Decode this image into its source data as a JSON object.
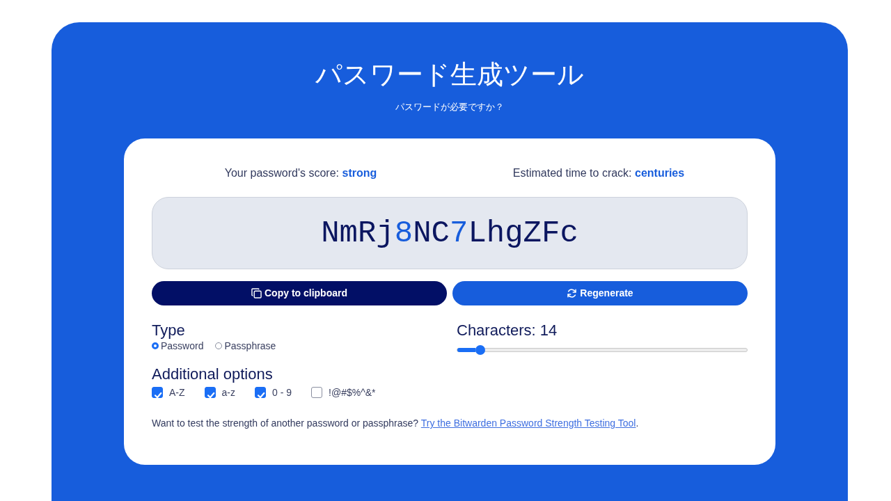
{
  "header": {
    "title": "パスワード生成ツール",
    "subtitle": "パスワードが必要ですか？"
  },
  "stats": [
    {
      "label": "Your password's score:",
      "value": "strong"
    },
    {
      "label": "Estimated time to crack:",
      "value": "centuries"
    }
  ],
  "password": [
    {
      "text": "NmRj",
      "kind": "letter"
    },
    {
      "text": "8",
      "kind": "digit"
    },
    {
      "text": "NC",
      "kind": "letter"
    },
    {
      "text": "7",
      "kind": "digit"
    },
    {
      "text": "LhgZFc",
      "kind": "letter"
    }
  ],
  "buttons": [
    {
      "label": "Copy to clipboard",
      "kind": "copy"
    },
    {
      "label": "Regenerate",
      "kind": "regenerate"
    }
  ],
  "type": {
    "heading": "Type",
    "options": [
      {
        "label": "Password",
        "selected": true
      },
      {
        "label": "Passphrase",
        "selected": false
      }
    ]
  },
  "length": {
    "label": "Characters: 14",
    "level": 0.08
  },
  "options": {
    "heading": "Additional options",
    "items": [
      {
        "label": "A-Z",
        "checked": true
      },
      {
        "label": "a-z",
        "checked": true
      },
      {
        "label": "0 - 9",
        "checked": true
      },
      {
        "label": "!@#$%^&*",
        "checked": false
      }
    ]
  },
  "footer": {
    "text": "Want to test the strength of another password or passphrase?",
    "link": "Try the Bitwarden Password Strength Testing Tool",
    "after": "."
  }
}
